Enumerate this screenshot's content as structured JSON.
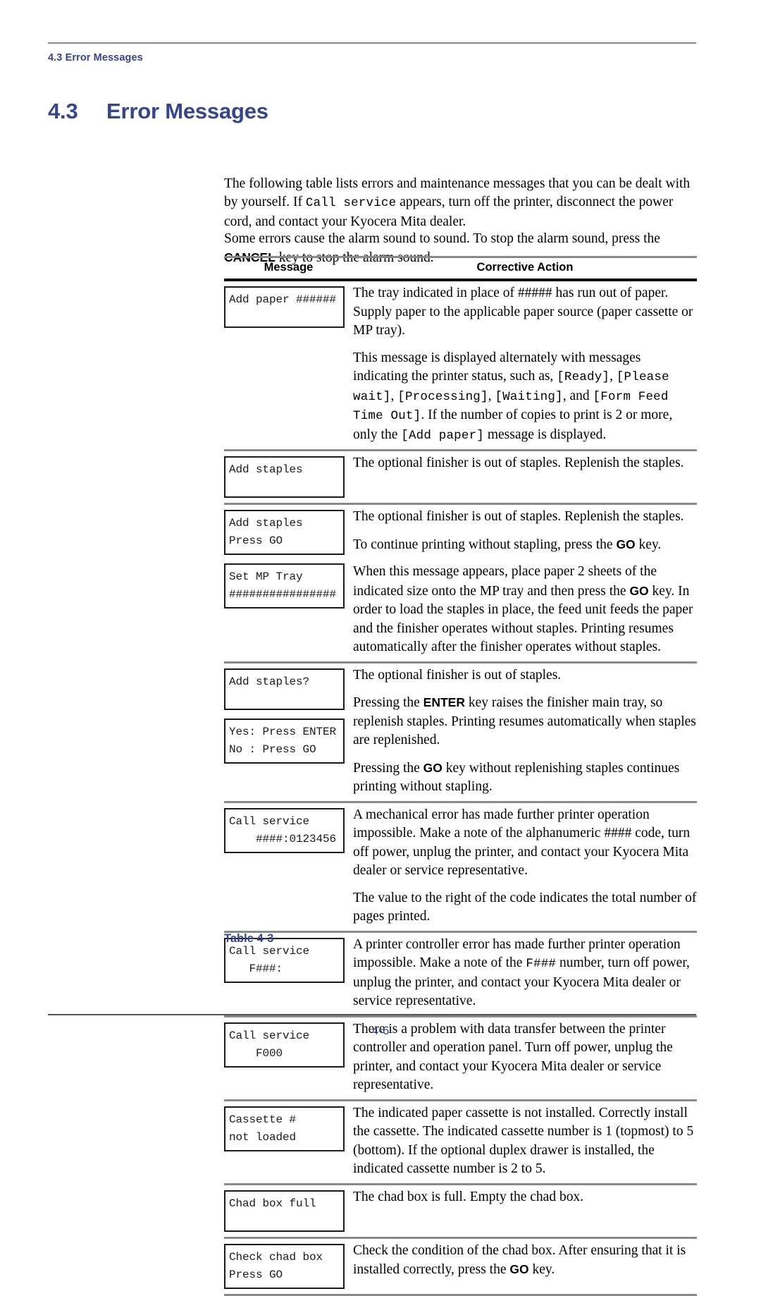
{
  "header": {
    "running_head": "4.3 Error Messages"
  },
  "section": {
    "number": "4.3",
    "title": "Error Messages"
  },
  "intro": {
    "p1_a": "The following table lists errors and maintenance messages that you can be dealt with by yourself. If ",
    "p1_code": "Call service",
    "p1_b": " appears, turn off the printer, disconnect the power cord, and contact your Kyocera Mita dealer.",
    "p2_a": "Some errors cause the alarm sound to sound. To stop the alarm sound, press the ",
    "p2_key": "CANCEL",
    "p2_b": " key to stop the alarm sound."
  },
  "table": {
    "caption": "Table 4-3",
    "columns": {
      "message": "Message",
      "action": "Corrective Action"
    },
    "rows": [
      {
        "lcd": "Add paper ######",
        "paragraphs": [
          {
            "segments": [
              {
                "t": "text",
                "v": "The tray indicated in place of ##### has run out of paper. Supply paper to the applicable paper source (paper cassette or MP tray)."
              }
            ]
          },
          {
            "segments": [
              {
                "t": "text",
                "v": "This message is displayed alternately with messages indicating the printer status, such as, "
              },
              {
                "t": "mono",
                "v": "[Ready]"
              },
              {
                "t": "text",
                "v": ", "
              },
              {
                "t": "mono",
                "v": "[Please wait]"
              },
              {
                "t": "text",
                "v": ", "
              },
              {
                "t": "mono",
                "v": "[Processing]"
              },
              {
                "t": "text",
                "v": ", "
              },
              {
                "t": "mono",
                "v": "[Waiting]"
              },
              {
                "t": "text",
                "v": ", and "
              },
              {
                "t": "mono",
                "v": "[Form Feed Time Out]"
              },
              {
                "t": "text",
                "v": ". If the number of copies to print is 2 or more, only the "
              },
              {
                "t": "mono",
                "v": "[Add paper]"
              },
              {
                "t": "text",
                "v": " message is displayed."
              }
            ]
          }
        ]
      },
      {
        "lcd": "Add staples",
        "paragraphs": [
          {
            "segments": [
              {
                "t": "text",
                "v": "The optional finisher is out of staples. Replenish the staples."
              }
            ]
          }
        ]
      },
      {
        "lcd": "Add staples\nPress GO",
        "lcd2": "Set MP Tray\n################",
        "paragraphs": [
          {
            "segments": [
              {
                "t": "text",
                "v": "The optional finisher is out of staples. Replenish the staples."
              }
            ]
          },
          {
            "segments": [
              {
                "t": "text",
                "v": "To continue printing without stapling, press the "
              },
              {
                "t": "kbd",
                "v": "GO"
              },
              {
                "t": "text",
                "v": " key."
              }
            ]
          },
          {
            "segments": [
              {
                "t": "text",
                "v": "When this message appears, place paper 2 sheets of the indicated size onto the MP tray and then press the "
              },
              {
                "t": "kbd",
                "v": "GO"
              },
              {
                "t": "text",
                "v": " key. In order to load the staples in place, the feed unit feeds the paper and the finisher operates without staples. Printing resumes automatically after the finisher operates without staples."
              }
            ]
          }
        ]
      },
      {
        "lcd": "Add staples?",
        "lcd2": "Yes: Press ENTER\nNo : Press GO",
        "paragraphs": [
          {
            "segments": [
              {
                "t": "text",
                "v": "The optional finisher is out of staples."
              }
            ]
          },
          {
            "segments": [
              {
                "t": "text",
                "v": "Pressing the "
              },
              {
                "t": "kbd",
                "v": "ENTER"
              },
              {
                "t": "text",
                "v": " key raises the finisher main tray, so replenish staples. Printing resumes automatically when staples are replenished."
              }
            ]
          },
          {
            "segments": [
              {
                "t": "text",
                "v": "Pressing the "
              },
              {
                "t": "kbd",
                "v": "GO"
              },
              {
                "t": "text",
                "v": " key without replenishing staples continues printing without stapling."
              }
            ]
          }
        ]
      },
      {
        "lcd": "Call service\n    ####:0123456",
        "paragraphs": [
          {
            "segments": [
              {
                "t": "text",
                "v": "A mechanical error has made further printer operation impossible. Make a note of the alphanumeric #### code, turn off power, unplug the printer, and contact your Kyocera Mita dealer or service representative."
              }
            ]
          },
          {
            "segments": [
              {
                "t": "text",
                "v": "The value to the right of the code indicates the total number of pages printed."
              }
            ]
          }
        ]
      },
      {
        "lcd": "Call service\n   F###:",
        "paragraphs": [
          {
            "segments": [
              {
                "t": "text",
                "v": "A printer controller error has made further printer operation impossible. Make a note of the "
              },
              {
                "t": "mono",
                "v": "F###"
              },
              {
                "t": "text",
                "v": " number, turn off power, unplug the printer, and contact your Kyocera Mita dealer or service representative."
              }
            ]
          }
        ]
      },
      {
        "lcd": "Call service\n    F000",
        "paragraphs": [
          {
            "segments": [
              {
                "t": "text",
                "v": "There is a problem with data transfer between the printer controller and operation panel. Turn off power, unplug the printer, and contact your Kyocera Mita dealer or service representative."
              }
            ]
          }
        ]
      },
      {
        "lcd": "Cassette #\nnot loaded",
        "paragraphs": [
          {
            "segments": [
              {
                "t": "text",
                "v": "The indicated paper cassette is not installed. Correctly install the cassette. The indicated cassette number is 1 (topmost) to 5 (bottom). If the optional duplex drawer is installed, the indicated cassette number is 2 to 5."
              }
            ]
          }
        ]
      },
      {
        "lcd": "Chad box full",
        "paragraphs": [
          {
            "segments": [
              {
                "t": "text",
                "v": "The chad box is full. Empty the chad box."
              }
            ]
          }
        ]
      },
      {
        "lcd": "Check chad box\nPress GO",
        "paragraphs": [
          {
            "segments": [
              {
                "t": "text",
                "v": "Check the condition of the chad box. After ensuring that it is installed correctly, press the "
              },
              {
                "t": "kbd",
                "v": "GO"
              },
              {
                "t": "text",
                "v": " key."
              }
            ]
          }
        ]
      }
    ]
  },
  "footer": {
    "page_number": "4-6"
  },
  "colors": {
    "accent_navy": "#36468c",
    "rule_gray": "#8a8a8a",
    "rule_black": "#000000"
  }
}
